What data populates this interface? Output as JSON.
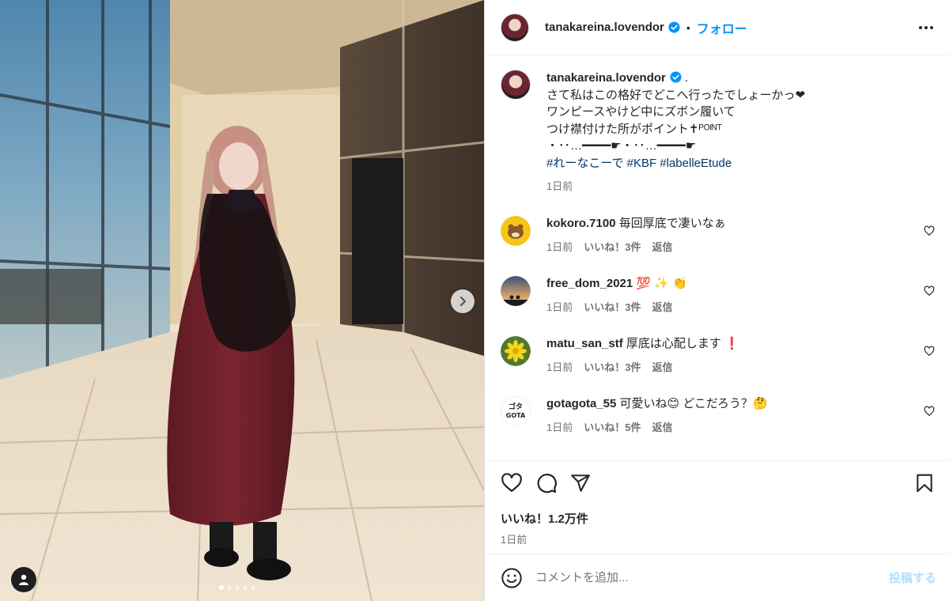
{
  "post": {
    "username": "tanakareina.lovendor",
    "separator": "•",
    "follow_label": "フォロー",
    "caption": {
      "username": "tanakareina.lovendor",
      "after_name": " .",
      "lines": [
        "さて私はこの格好でどこへ行ったでしょーかっ❤",
        "ワンピースやけど中にズボン履いて",
        "つけ襟付けた所がポイント✝ᴾᴼᴵᴺᵀ",
        "・･･…━━━━☛・･･…━━━━☛"
      ],
      "hashtags": "#れーなこーで #KBF #labelleEtude",
      "time": "1日前"
    },
    "comments": [
      {
        "username": "kokoro.7100",
        "text": "毎回厚底で凄いなぁ",
        "time": "1日前",
        "likes": "いいね！3件",
        "reply": "返信"
      },
      {
        "username": "free_dom_2021",
        "text": "💯 ✨ 👏",
        "time": "1日前",
        "likes": "いいね！3件",
        "reply": "返信"
      },
      {
        "username": "matu_san_stf",
        "text": "厚底は心配します ❗",
        "time": "1日前",
        "likes": "いいね！3件",
        "reply": "返信"
      },
      {
        "username": "gotagota_55",
        "text": "可愛いね😊 どこだろう？🤔",
        "time": "1日前",
        "likes": "いいね！5件",
        "reply": "返信"
      }
    ],
    "gota_avatar_text": {
      "top": "ゴタ",
      "bottom": "GOTA"
    },
    "like_count": "いいね！1.2万件",
    "post_time": "1日前",
    "comment_placeholder": "コメントを追加...",
    "post_button": "投稿する",
    "colors": {
      "accent": "#0095f6",
      "hashtag": "#00376b",
      "muted": "#737373"
    },
    "icons": [
      "verified-badge-icon",
      "more-options-icon",
      "next-arrow-icon",
      "tag-user-icon",
      "heart-icon",
      "comment-icon",
      "share-icon",
      "save-icon",
      "emoji-icon"
    ]
  }
}
